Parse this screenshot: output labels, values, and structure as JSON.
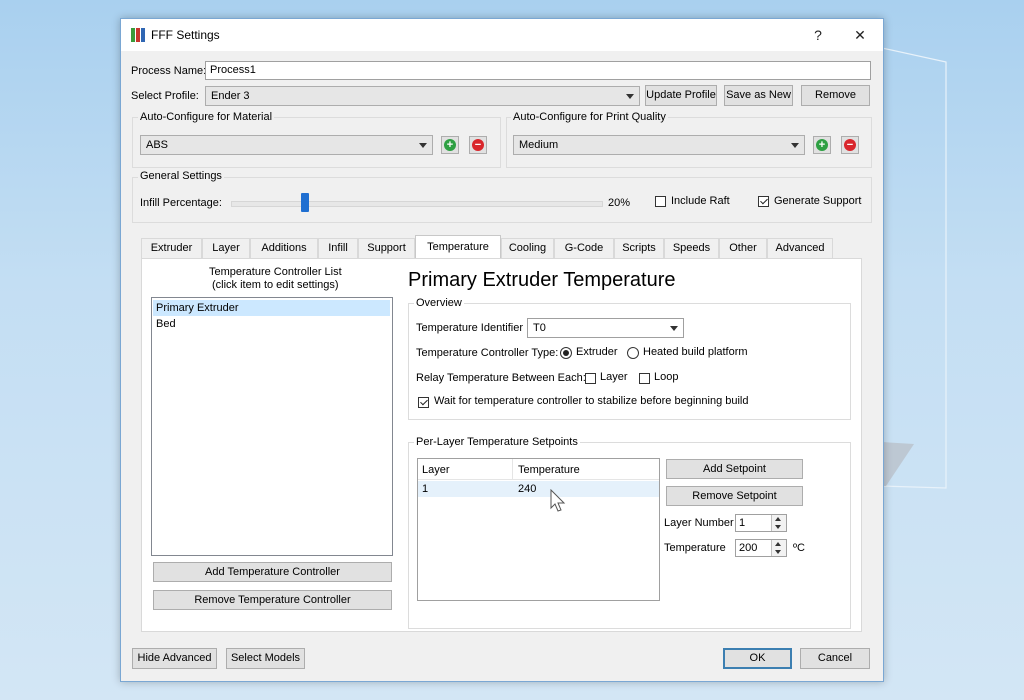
{
  "window": {
    "title": "FFF Settings",
    "help_glyph": "?",
    "close_glyph": "✕"
  },
  "process": {
    "label": "Process Name:",
    "value": "Process1"
  },
  "profile": {
    "label": "Select Profile:",
    "value": "Ender 3",
    "update_label": "Update Profile",
    "save_new_label": "Save as New",
    "remove_label": "Remove"
  },
  "material": {
    "group_title": "Auto-Configure for Material",
    "value": "ABS"
  },
  "quality": {
    "group_title": "Auto-Configure for Print Quality",
    "value": "Medium"
  },
  "general": {
    "group_title": "General Settings",
    "infill_label": "Infill Percentage:",
    "infill_value_text": "20%",
    "infill_fraction": 0.2,
    "raft_label": "Include Raft",
    "raft_checked": false,
    "support_label": "Generate Support",
    "support_checked": true
  },
  "tabs": [
    "Extruder",
    "Layer",
    "Additions",
    "Infill",
    "Support",
    "Temperature",
    "Cooling",
    "G-Code",
    "Scripts",
    "Speeds",
    "Other",
    "Advanced"
  ],
  "active_tab": "Temperature",
  "temp": {
    "list_title_1": "Temperature Controller List",
    "list_title_2": "(click item to edit settings)",
    "controllers": [
      "Primary Extruder",
      "Bed"
    ],
    "selected_controller": "Primary Extruder",
    "add_controller_label": "Add Temperature Controller",
    "remove_controller_label": "Remove Temperature Controller",
    "heading": "Primary Extruder Temperature",
    "overview_title": "Overview",
    "identifier_label": "Temperature Identifier",
    "identifier_value": "T0",
    "type_label": "Temperature Controller Type:",
    "type_extruder": "Extruder",
    "type_platform": "Heated build platform",
    "relay_label": "Relay Temperature Between Each:",
    "relay_layer": "Layer",
    "relay_loop": "Loop",
    "wait_label": "Wait for temperature controller to stabilize before beginning build",
    "setpoints_title": "Per-Layer Temperature Setpoints",
    "col_layer": "Layer",
    "col_temp": "Temperature",
    "rows": [
      {
        "layer": "1",
        "temp": "240"
      }
    ],
    "add_setpoint_label": "Add Setpoint",
    "remove_setpoint_label": "Remove Setpoint",
    "layer_number_label": "Layer Number",
    "layer_number_value": "1",
    "temperature_label": "Temperature",
    "temperature_value": "200",
    "unit": "ºC"
  },
  "footer": {
    "hide_advanced_label": "Hide Advanced",
    "select_models_label": "Select Models",
    "ok_label": "OK",
    "cancel_label": "Cancel"
  },
  "colors": {
    "accent": "#3c7fb1",
    "add_green": "#2ea043",
    "remove_red": "#d9262c",
    "slider_thumb": "#1f6fd1",
    "selection": "#cce8ff"
  }
}
